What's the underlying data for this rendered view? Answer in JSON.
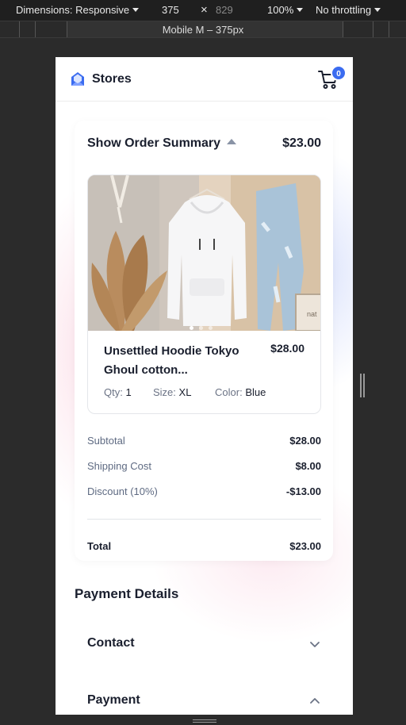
{
  "devtools": {
    "dimensions_label": "Dimensions: Responsive",
    "width": "375",
    "times": "×",
    "height": "829",
    "zoom": "100%",
    "throttling": "No throttling",
    "device_label": "Mobile M – 375px"
  },
  "header": {
    "brand": "Stores",
    "cart_count": "0"
  },
  "summary": {
    "title": "Show Order Summary",
    "total": "$23.00",
    "product": {
      "name": "Unsettled Hoodie Tokyo Ghoul cotton...",
      "price": "$28.00",
      "qty_label": "Qty:",
      "qty": "1",
      "size_label": "Size:",
      "size": "XL",
      "color_label": "Color:",
      "color": "Blue",
      "photo_text": "nat"
    },
    "lines": [
      {
        "label": "Subtotal",
        "value": "$28.00"
      },
      {
        "label": "Shipping Cost",
        "value": "$8.00"
      },
      {
        "label": "Discount (10%)",
        "value": "-$13.00"
      }
    ],
    "total_row": {
      "label": "Total",
      "value": "$23.00"
    }
  },
  "payment": {
    "title": "Payment Details",
    "sections": [
      {
        "label": "Contact",
        "state": "collapsed"
      },
      {
        "label": "Payment",
        "state": "expanded"
      }
    ]
  },
  "colors": {
    "accent": "#3b6cf0",
    "text": "#1a1f2e",
    "muted": "#5e6a82"
  }
}
